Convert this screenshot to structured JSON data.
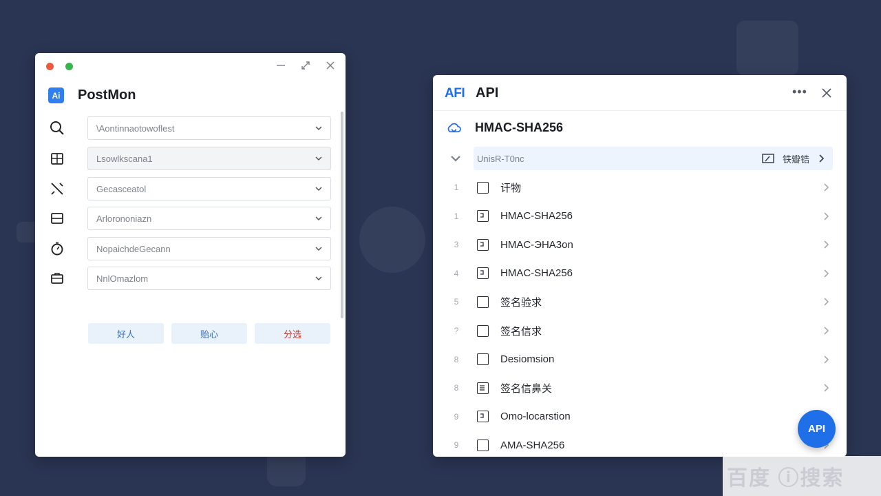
{
  "left_window": {
    "brand": {
      "logo_text": "Ai",
      "title": "PostMon"
    },
    "fields": [
      {
        "icon": "search-icon",
        "value": "\\Aontinnaotowoflest"
      },
      {
        "icon": "calendar-icon",
        "value": "Lsowlkscana1"
      },
      {
        "icon": "tools-icon",
        "value": "Gecasceatol"
      },
      {
        "icon": "card-icon",
        "value": "Arlorononiazn"
      },
      {
        "icon": "timer-icon",
        "value": "NopaichdeGecann"
      },
      {
        "icon": "briefcase-icon",
        "value": "NnlOmazlom"
      }
    ],
    "buttons": [
      "好人",
      "贻心",
      "分选"
    ]
  },
  "right_window": {
    "header": {
      "logo_text": "AFI",
      "title": "API"
    },
    "subheader": {
      "title": "HMAC-SHA256"
    },
    "select_row": {
      "label": "UnisR-T0nc",
      "action_label": "铁瓣锆"
    },
    "items": [
      {
        "num": "1",
        "icon": "checkbox",
        "label": "讦物"
      },
      {
        "num": "1",
        "icon": "doc",
        "label": "HMAC-SHA256"
      },
      {
        "num": "3",
        "icon": "doc",
        "label": "HMAC-ЭHA3on"
      },
      {
        "num": "4",
        "icon": "doc",
        "label": "HMAC-SHA256"
      },
      {
        "num": "5",
        "icon": "checkbox",
        "label": "签名验求"
      },
      {
        "num": "?",
        "icon": "checkbox",
        "label": "签名信求"
      },
      {
        "num": "8",
        "icon": "checkbox",
        "label": "Desiomsion"
      },
      {
        "num": "8",
        "icon": "list",
        "label": "签名信鼻关"
      },
      {
        "num": "9",
        "icon": "doc",
        "label": "Omo-locarstion"
      },
      {
        "num": "9",
        "icon": "checkbox",
        "label": "AMA-SHA256"
      }
    ]
  },
  "fab": {
    "label": "API"
  },
  "colors": {
    "accent": "#1f6fe8",
    "background": "#2a3553"
  }
}
